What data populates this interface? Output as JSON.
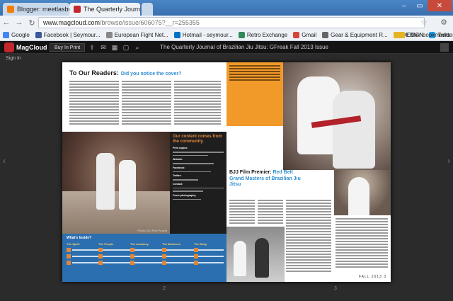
{
  "browser": {
    "tabs": [
      {
        "label": "Blogger: meetlasbu - Crea...",
        "active": false,
        "favicon_color": "#f57c00"
      },
      {
        "label": "The Quarterly Journa...",
        "active": true,
        "favicon_color": "#c1272d"
      }
    ],
    "window_buttons": {
      "minimize": "–",
      "maximize": "▭",
      "close": "✕"
    },
    "nav": {
      "back": "←",
      "forward": "→",
      "reload": "↻"
    },
    "url_host": "www.magcloud.com",
    "url_path": "/browse/issue/606075?__r=255355",
    "bookmarks": [
      {
        "label": "Google",
        "color": "#4285f4"
      },
      {
        "label": "Facebook | Seymour...",
        "color": "#3b5998"
      },
      {
        "label": "European Fight Net...",
        "color": "#888888"
      },
      {
        "label": "Hotmail - seymour...",
        "color": "#0072c6"
      },
      {
        "label": "Retro Exchange",
        "color": "#2e8b57"
      },
      {
        "label": "Gmail",
        "color": "#d44638"
      },
      {
        "label": "Gear & Equipment R...",
        "color": "#666666"
      },
      {
        "label": "DESIGN",
        "color": "#e6b422"
      },
      {
        "label": "Twitter / Home",
        "color": "#1da1f2"
      }
    ],
    "other_bookmarks": "Other bookmarks"
  },
  "magcloud": {
    "logo": "MagCloud",
    "buy_label": "Buy In Print",
    "title": "The Quarterly Journal of Brazilian Jiu Jitsu: GFreak Fall 2013 Issue",
    "sign_in": "Sign In",
    "page_left": "2",
    "page_right": "3"
  },
  "magazine": {
    "readers_title": "To Our Readers:",
    "readers_sub": "Did you notice the cover?",
    "content_box": "Our content comes from the community.",
    "content_labels": [
      "Print copies:",
      "Website:",
      "Facebook:",
      "Twitter:",
      "Contact:",
      "Cover photography:"
    ],
    "whats_inside": "What's Inside?",
    "columns": [
      "The Spirit",
      "The People",
      "The Academy",
      "The Business",
      "The Body"
    ],
    "photo_credit": "Photo: BJJ Film Project",
    "film_title_1": "BJJ Film Premier:",
    "film_title_2": "Red Belt Grand Masters of Brazilian Jiu Jitsu",
    "page_footer": "FALL 2013 3"
  }
}
